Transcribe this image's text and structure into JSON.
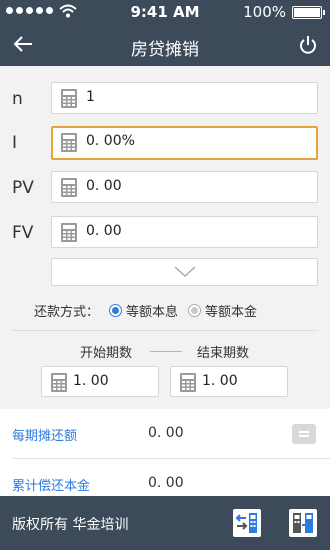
{
  "status_bar": {
    "time": "9:41 AM",
    "battery": "100%"
  },
  "nav": {
    "title": "房贷摊销",
    "back_icon": "back-arrow-icon",
    "power_icon": "power-icon"
  },
  "fields": [
    {
      "label": "n",
      "value": "1"
    },
    {
      "label": "I",
      "value": "0. 00%"
    },
    {
      "label": "PV",
      "value": "0. 00"
    },
    {
      "label": "FV",
      "value": "0. 00"
    }
  ],
  "repayment": {
    "label": "还款方式：",
    "options": [
      "等额本息",
      "等额本金"
    ],
    "selected": "等额本息"
  },
  "period": {
    "start_label": "开始期数",
    "end_label": "结束期数",
    "start_value": "1. 00",
    "end_value": "1. 00"
  },
  "results": [
    {
      "label": "每期摊还额",
      "value": "0. 00"
    },
    {
      "label": "累计偿还本金",
      "value": "0. 00"
    }
  ],
  "footer": {
    "copyright": "版权所有  华金培训"
  },
  "colors": {
    "header_bg": "#3d4a59",
    "accent_blue": "#2d7be0",
    "focus_border": "#e8a23c"
  }
}
